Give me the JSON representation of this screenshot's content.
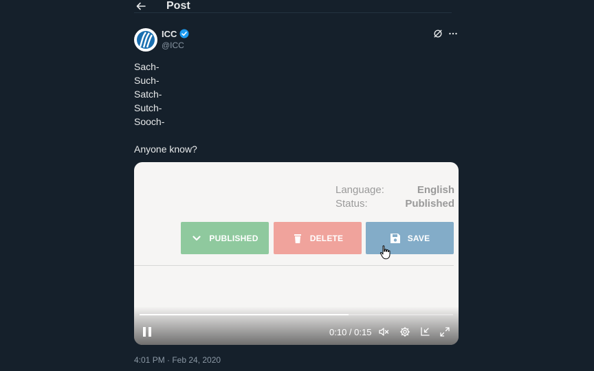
{
  "header": {
    "title": "Post"
  },
  "author": {
    "name": "ICC",
    "handle": "@ICC"
  },
  "post": {
    "lines": [
      "Sach-",
      "Such-",
      "Satch-",
      "Sutch-",
      "Sooch-",
      "",
      "Anyone know?"
    ],
    "timestamp": "4:01 PM · Feb 24, 2020"
  },
  "video": {
    "language_label": "Language:",
    "language_value": "English",
    "status_label": "Status:",
    "status_value": "Published",
    "buttons": {
      "published": "PUBLISHED",
      "delete": "DELETE",
      "save": "SAVE"
    },
    "time": "0:10 / 0:15",
    "progress": 0.667
  },
  "colors": {
    "background": "#15202b",
    "verified": "#1d9bf0",
    "published_button": "#8fc99e",
    "delete_button": "#f0a39c",
    "save_button": "#83acc8"
  },
  "icons": [
    "back-arrow-icon",
    "verified-badge-icon",
    "grok-icon",
    "more-icon",
    "chevron-down-icon",
    "trash-icon",
    "floppy-disk-icon",
    "hand-cursor-icon",
    "pause-icon",
    "mute-icon",
    "settings-gear-icon",
    "dock-icon",
    "fullscreen-icon"
  ]
}
